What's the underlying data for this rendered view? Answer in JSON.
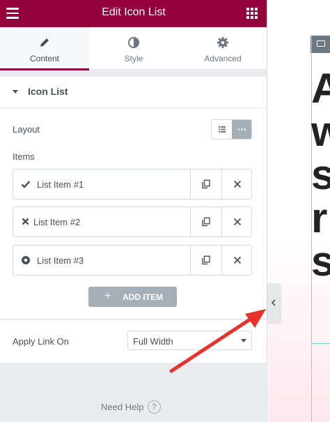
{
  "header": {
    "title": "Edit Icon List"
  },
  "tabs": [
    {
      "label": "Content",
      "icon": "pencil-icon",
      "active": true
    },
    {
      "label": "Style",
      "icon": "half-circle-icon",
      "active": false
    },
    {
      "label": "Advanced",
      "icon": "gear-icon",
      "active": false
    }
  ],
  "section": {
    "title": "Icon List"
  },
  "fields": {
    "layout_label": "Layout",
    "layout_selected": "inline",
    "items_label": "Items"
  },
  "items": [
    {
      "label": "List Item #1",
      "icon": "check-icon"
    },
    {
      "label": "List Item #2",
      "icon": "times-icon"
    },
    {
      "label": "List Item #3",
      "icon": "dot-circle-icon"
    }
  ],
  "add_item_label": "ADD ITEM",
  "apply_link": {
    "label": "Apply Link On",
    "value": "Full Width"
  },
  "footer": {
    "need_help": "Need Help",
    "help_glyph": "?"
  },
  "preview": {
    "text": "A\nw\ns\nr\ns"
  },
  "colors": {
    "brand": "#93003c",
    "arrow": "#e8312a",
    "frame_accent": "#71d7f7"
  }
}
